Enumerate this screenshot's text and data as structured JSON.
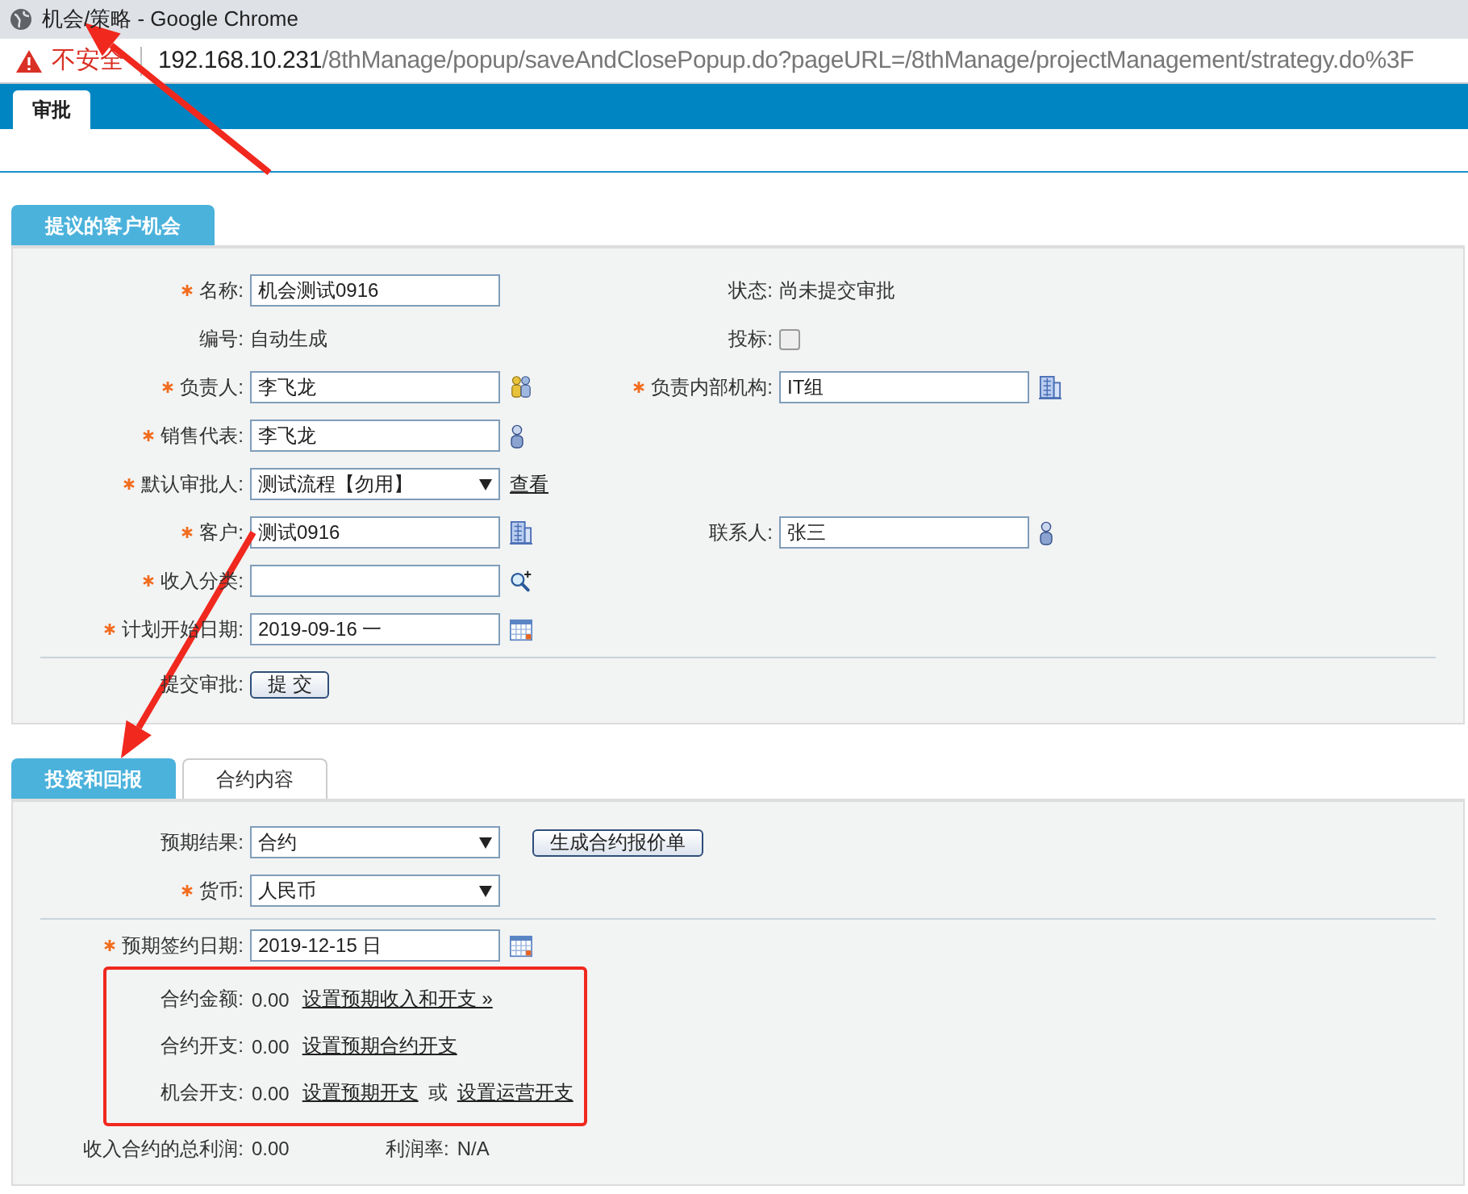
{
  "window": {
    "title": "机会/策略 - Google Chrome"
  },
  "address_bar": {
    "security_label": "不安全",
    "host": "192.168.10.231",
    "path": "/8thManage/popup/saveAndClosePopup.do?pageURL=/8thManage/projectManagement/strategy.do%3F"
  },
  "top_tabs": [
    {
      "label": "审批",
      "selected": true
    }
  ],
  "proposal": {
    "tabs": [
      {
        "label": "提议的客户机会",
        "selected": true
      }
    ],
    "groups": [
      [
        {
          "left": {
            "label": "名称:",
            "required": true,
            "kind": "text",
            "value": "机会测试0916"
          },
          "right": {
            "label": "状态:",
            "required": false,
            "kind": "static",
            "value": "尚未提交审批"
          }
        },
        {
          "left": {
            "label": "编号:",
            "required": false,
            "kind": "static",
            "value": "自动生成"
          },
          "right": {
            "label": "投标:",
            "required": false,
            "kind": "checkbox",
            "checked": false
          }
        },
        {
          "left": {
            "label": "负责人:",
            "required": true,
            "kind": "text",
            "value": "李飞龙",
            "picker": {
              "kind": "group"
            }
          },
          "right": {
            "label": "负责内部机构:",
            "required": true,
            "kind": "text",
            "value": "IT组",
            "picker": {
              "kind": "org"
            }
          }
        },
        {
          "left": {
            "label": "销售代表:",
            "required": true,
            "kind": "text",
            "value": "李飞龙",
            "picker": {
              "kind": "user"
            }
          }
        },
        {
          "left": {
            "label": "默认审批人:",
            "required": true,
            "kind": "select",
            "value": "测试流程【勿用】",
            "link": "查看"
          }
        },
        {
          "left": {
            "label": "客户:",
            "required": true,
            "kind": "text",
            "value": "测试0916",
            "picker": {
              "kind": "org"
            }
          },
          "right": {
            "label": "联系人:",
            "required": false,
            "kind": "text",
            "value": "张三",
            "picker": {
              "kind": "user"
            }
          }
        },
        {
          "left": {
            "label": "收入分类:",
            "required": true,
            "kind": "text",
            "picker": {
              "kind": "search"
            }
          }
        },
        {
          "left": {
            "label": "计划开始日期:",
            "required": true,
            "kind": "text",
            "value": "2019-09-16 一",
            "picker": {
              "kind": "calendar"
            }
          }
        }
      ],
      [
        {
          "left": {
            "label": "提交审批:",
            "required": false,
            "kind": "button",
            "value": "提 交"
          }
        }
      ]
    ]
  },
  "investment": {
    "tabs": [
      {
        "label": "投资和回报",
        "selected": true
      },
      {
        "label": "合约内容",
        "selected": false
      }
    ],
    "groups": [
      [
        {
          "left": {
            "label": "预期结果:",
            "required": false,
            "kind": "select",
            "value": "合约"
          },
          "button": "生成合约报价单"
        },
        {
          "left": {
            "label": "货币:",
            "required": true,
            "kind": "select",
            "value": "人民币"
          }
        }
      ],
      [
        {
          "left": {
            "label": "预期签约日期:",
            "required": true,
            "kind": "text",
            "value": "2019-12-15 日",
            "picker": {
              "kind": "calendar"
            }
          }
        }
      ]
    ],
    "amounts": {
      "highlighted": true,
      "rows": [
        {
          "label": "合约金额:",
          "value": "0.00",
          "links": [
            "设置预期收入和开支 »"
          ]
        },
        {
          "label": "合约开支:",
          "value": "0.00",
          "links": [
            "设置预期合约开支"
          ]
        },
        {
          "label": "机会开支:",
          "value": "0.00",
          "links": [
            "设置预期开支",
            "设置运营开支"
          ],
          "separator": "或"
        }
      ]
    },
    "totals": [
      {
        "label": "收入合约的总利润:",
        "value": "0.00"
      },
      {
        "label": "利润率:",
        "value": "N/A"
      }
    ]
  },
  "annotations": [
    {
      "kind": "arrow"
    },
    {
      "kind": "arrow"
    }
  ]
}
